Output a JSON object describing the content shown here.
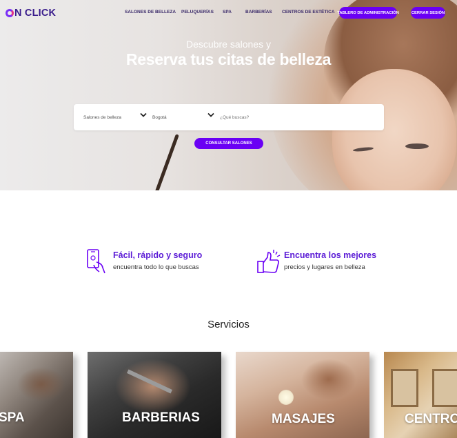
{
  "brand": {
    "logo_text": "N CLICK"
  },
  "nav": {
    "links": [
      "SALONES DE BELLEZA",
      "PELUQUERÍAS",
      "SPA",
      "BARBERÍAS",
      "CENTROS DE ESTÉTICA"
    ],
    "admin_button": "TABLERO DE ADMINISTRACIÓN",
    "logout_button": "CERRAR SESIÓN"
  },
  "hero": {
    "subtitle": "Descubre salones y",
    "title": "Reserva tus citas de belleza"
  },
  "search": {
    "category_value": "Salones de belleza",
    "city_value": "Bogotá",
    "placeholder": "¿Qué buscas?",
    "submit_label": "CONSULTAR SALONES"
  },
  "features": [
    {
      "title": "Fácil, rápido y seguro",
      "text": "encuentra todo lo que buscas",
      "icon": "phone-hand-icon"
    },
    {
      "title": "Encuentra los mejores",
      "text": "precios y lugares en belleza",
      "icon": "thumbs-up-icon"
    }
  ],
  "services": {
    "heading": "Servicios",
    "cards": [
      "SPA",
      "BARBERIAS",
      "MASAJES",
      "CENTROS DE BELLEZA"
    ]
  },
  "colors": {
    "accent": "#6a00f4",
    "feature_title": "#5b1bd6",
    "logo": "#3a1d8c"
  }
}
